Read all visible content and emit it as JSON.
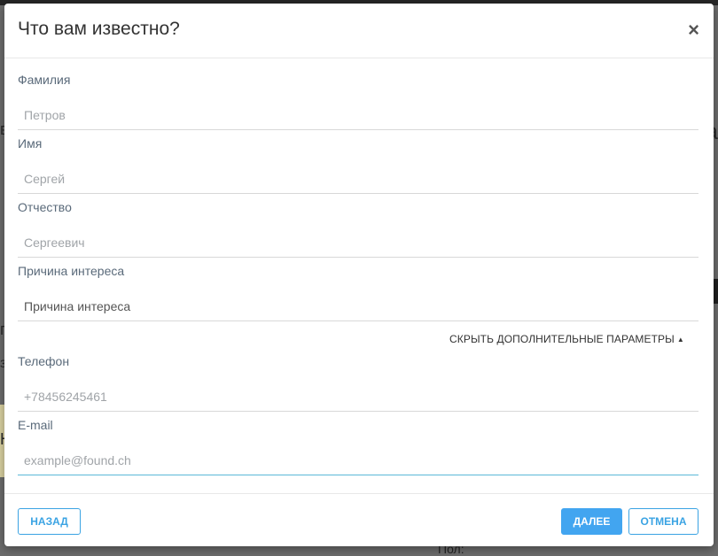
{
  "background": {
    "fragments": [
      "в",
      "За",
      "п",
      "з",
      "Н"
    ],
    "pol_label": "Пол:"
  },
  "modal": {
    "title": "Что вам известно?",
    "close_symbol": "×"
  },
  "fields": {
    "surname": {
      "label": "Фамилия",
      "placeholder": "Петров",
      "value": ""
    },
    "name": {
      "label": "Имя",
      "placeholder": "Сергей",
      "value": ""
    },
    "patronymic": {
      "label": "Отчество",
      "placeholder": "Сергеевич",
      "value": ""
    },
    "reason": {
      "label": "Причина интереса",
      "placeholder": "Причина интереса",
      "value": "Причина интереса"
    },
    "phone": {
      "label": "Телефон",
      "placeholder": "+78456245461",
      "value": ""
    },
    "email": {
      "label": "E-mail",
      "placeholder": "example@found.ch",
      "value": ""
    }
  },
  "toggle": {
    "label": "СКРЫТЬ ДОПОЛНИТЕЛЬНЫЕ ПАРАМЕТРЫ",
    "caret": "▲"
  },
  "footer": {
    "back_label": "НАЗАД",
    "next_label": "ДАЛЕЕ",
    "cancel_label": "ОТМЕНА"
  },
  "colors": {
    "accent": "#42a5f0",
    "overlay": "#6b6b6b"
  }
}
